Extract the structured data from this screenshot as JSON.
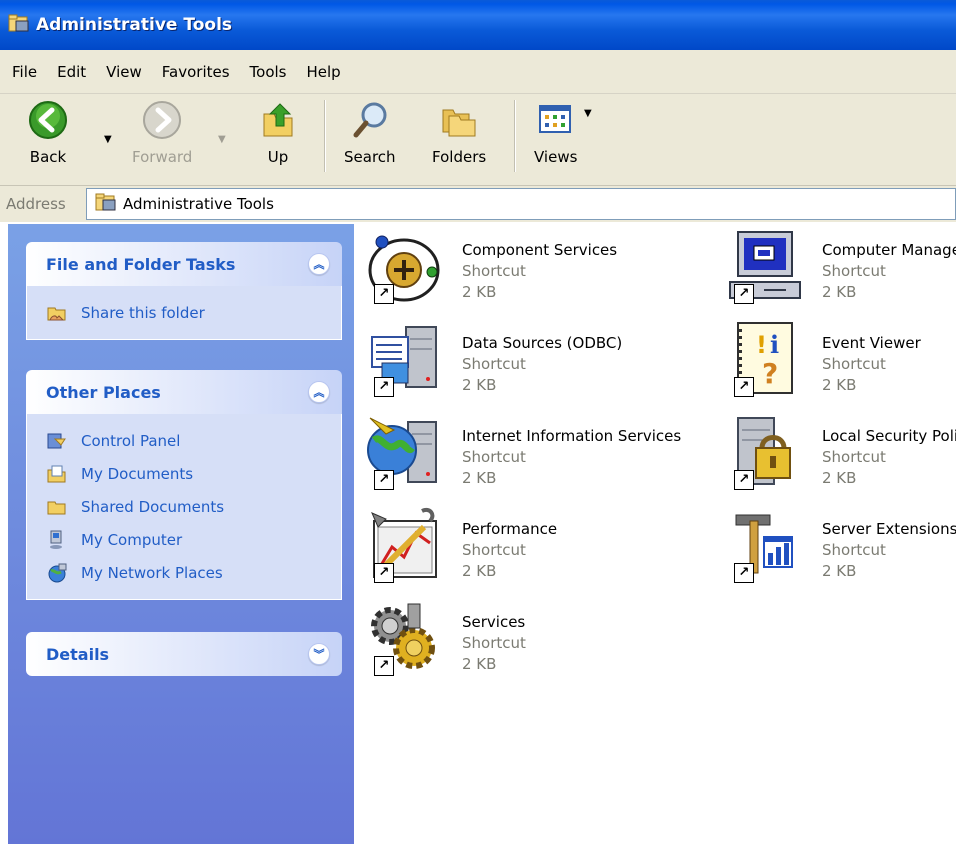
{
  "window": {
    "title": "Administrative Tools"
  },
  "menu": [
    "File",
    "Edit",
    "View",
    "Favorites",
    "Tools",
    "Help"
  ],
  "toolbar": {
    "back": "Back",
    "forward": "Forward",
    "up": "Up",
    "search": "Search",
    "folders": "Folders",
    "views": "Views"
  },
  "address": {
    "label": "Address",
    "value": "Administrative Tools"
  },
  "sidebar": {
    "file_tasks": {
      "title": "File and Folder Tasks",
      "items": [
        "Share this folder"
      ]
    },
    "other_places": {
      "title": "Other Places",
      "items": [
        "Control Panel",
        "My Documents",
        "Shared Documents",
        "My Computer",
        "My Network Places"
      ]
    },
    "details": {
      "title": "Details"
    }
  },
  "items": [
    {
      "name": "Component Services",
      "type": "Shortcut",
      "size": "2 KB",
      "icon": "component-services-icon"
    },
    {
      "name": "Computer Management",
      "type": "Shortcut",
      "size": "2 KB",
      "icon": "computer-management-icon"
    },
    {
      "name": "Data Sources (ODBC)",
      "type": "Shortcut",
      "size": "2 KB",
      "icon": "data-sources-icon"
    },
    {
      "name": "Event Viewer",
      "type": "Shortcut",
      "size": "2 KB",
      "icon": "event-viewer-icon"
    },
    {
      "name": "Internet Information Services",
      "type": "Shortcut",
      "size": "2 KB",
      "icon": "iis-icon"
    },
    {
      "name": "Local Security Policy",
      "type": "Shortcut",
      "size": "2 KB",
      "icon": "local-security-policy-icon"
    },
    {
      "name": "Performance",
      "type": "Shortcut",
      "size": "2 KB",
      "icon": "performance-icon"
    },
    {
      "name": "Server Extensions",
      "type": "Shortcut",
      "size": "2 KB",
      "icon": "server-extensions-icon"
    },
    {
      "name": "Services",
      "type": "Shortcut",
      "size": "2 KB",
      "icon": "services-icon"
    }
  ]
}
